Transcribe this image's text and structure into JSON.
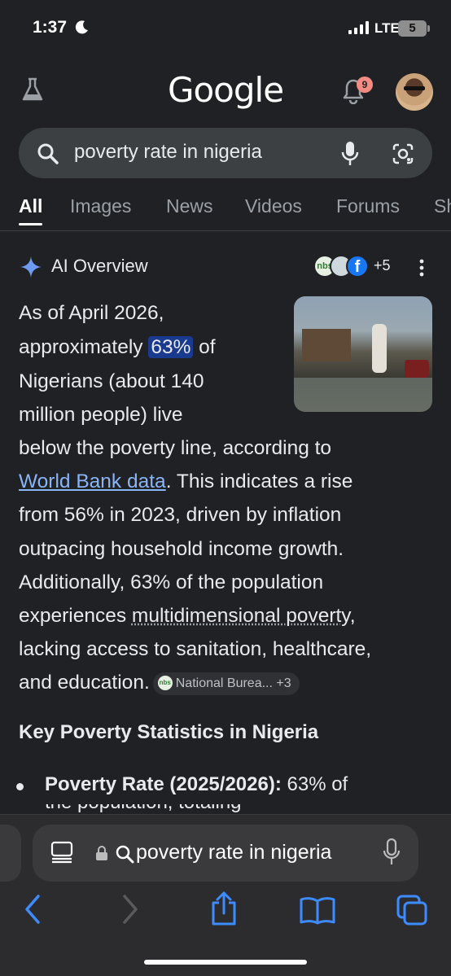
{
  "status_bar": {
    "time": "1:37",
    "network": "LTE",
    "battery": "5"
  },
  "header": {
    "logo": "Google",
    "notification_count": "9"
  },
  "search": {
    "query": "poverty rate in nigeria"
  },
  "tabs": [
    "All",
    "Images",
    "News",
    "Videos",
    "Forums",
    "Sh"
  ],
  "ai_overview": {
    "title": "AI Overview",
    "chip_label": "nbs",
    "chip_fb": "f",
    "more_sources": "+5",
    "lines": {
      "l1": "As of April 2026,",
      "l2_a": "approximately ",
      "l2_hl": "63%",
      "l2_b": " of",
      "l3": "Nigerians (about 140",
      "l4": "million people) live",
      "l5": "below the poverty line, according to",
      "l6_link": "World Bank data",
      "l6_b": ". This indicates a rise",
      "l7": "from 56% in 2023, driven by inflation",
      "l8": "outpacing household income growth.",
      "l9": "Additionally, 63% of the population",
      "l10_a": "experiences ",
      "l10_dotted": "multidimensional poverty",
      "l10_b": ",",
      "l11": "lacking access to sanitation, healthcare,",
      "l12": "and education."
    },
    "citation": {
      "logo": "nbs",
      "label": "National Burea...",
      "count": "+3"
    },
    "section_heading": "Key Poverty Statistics in Nigeria",
    "bullet": {
      "bold": "Poverty Rate (2025/2026):",
      "text": " 63% of",
      "next_line": "the population, totaling"
    }
  },
  "safari": {
    "address": "poverty rate in nigeria"
  },
  "colors": {
    "background": "#202124",
    "link": "#8ab4f8",
    "highlight": "#1a3a8f",
    "safari_accent": "#3d8bff"
  }
}
